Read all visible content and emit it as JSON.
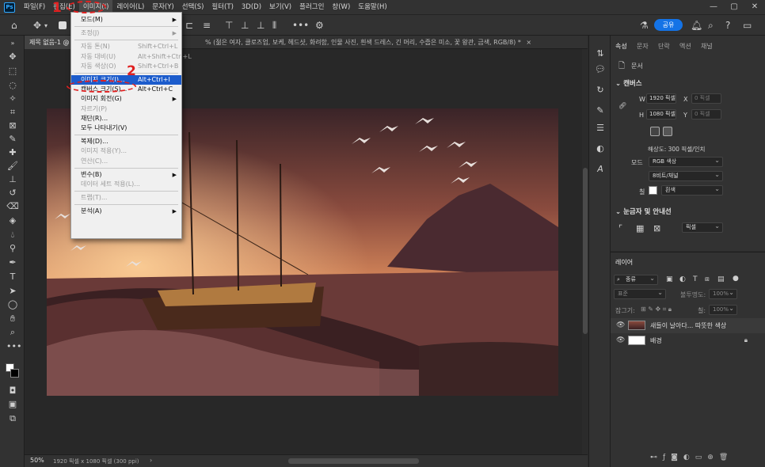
{
  "app": {
    "logo": "Ps"
  },
  "menubar": {
    "items": [
      "파일(F)",
      "편집(E)",
      "이미지(I)",
      "레이어(L)",
      "문자(Y)",
      "선택(S)",
      "필터(T)",
      "3D(D)",
      "보기(V)",
      "플러그인",
      "창(W)",
      "도움말(H)"
    ],
    "active_index": 2
  },
  "window": {
    "minimize": "—",
    "maximize": "▢",
    "close": "✕"
  },
  "options_bar": {
    "share_label": "공유"
  },
  "document": {
    "tab_title": "제목 없음-1 @",
    "tab_suffix": "% (젊은 여자, 클로즈업, 보케, 헤드샷, 화려함, 인물 사진, 흰색 드레스, 긴 머리, 수줍은 미소, 꽃 왕관, 금색, RGB/8) *",
    "tab_close": "×"
  },
  "status": {
    "zoom": "50%",
    "info": "1920 픽셀 x 1080 픽셀 (300 ppi)",
    "arrow": "›"
  },
  "image_menu": {
    "items": [
      {
        "label": "모드(M)",
        "shortcut": "",
        "submenu": true,
        "enabled": true
      },
      {
        "sep": true
      },
      {
        "label": "조정(J)",
        "shortcut": "",
        "submenu": true,
        "enabled": false
      },
      {
        "sep": true
      },
      {
        "label": "자동 톤(N)",
        "shortcut": "Shift+Ctrl+L",
        "submenu": false,
        "enabled": false
      },
      {
        "label": "자동 대비(U)",
        "shortcut": "Alt+Shift+Ctrl+L",
        "submenu": false,
        "enabled": false
      },
      {
        "label": "자동 색상(O)",
        "shortcut": "Shift+Ctrl+B",
        "submenu": false,
        "enabled": false
      },
      {
        "sep": true
      },
      {
        "label": "이미지 크기(I)...",
        "shortcut": "Alt+Ctrl+I",
        "submenu": false,
        "enabled": true,
        "highlighted": true
      },
      {
        "label": "캔버스 크기(S)...",
        "shortcut": "Alt+Ctrl+C",
        "submenu": false,
        "enabled": true
      },
      {
        "label": "이미지 회전(G)",
        "shortcut": "",
        "submenu": true,
        "enabled": true
      },
      {
        "label": "자르기(P)",
        "shortcut": "",
        "submenu": false,
        "enabled": false
      },
      {
        "label": "재단(R)...",
        "shortcut": "",
        "submenu": false,
        "enabled": true
      },
      {
        "label": "모두 나타내기(V)",
        "shortcut": "",
        "submenu": false,
        "enabled": true
      },
      {
        "sep": true
      },
      {
        "label": "복제(D)...",
        "shortcut": "",
        "submenu": false,
        "enabled": true
      },
      {
        "label": "이미지 적용(Y)...",
        "shortcut": "",
        "submenu": false,
        "enabled": false
      },
      {
        "label": "연산(C)...",
        "shortcut": "",
        "submenu": false,
        "enabled": false
      },
      {
        "sep": true
      },
      {
        "label": "변수(B)",
        "shortcut": "",
        "submenu": true,
        "enabled": true
      },
      {
        "label": "데이터 세트 적용(L)...",
        "shortcut": "",
        "submenu": false,
        "enabled": false
      },
      {
        "sep": true
      },
      {
        "label": "트랩(T)...",
        "shortcut": "",
        "submenu": false,
        "enabled": false
      },
      {
        "sep": true
      },
      {
        "label": "분석(A)",
        "shortcut": "",
        "submenu": true,
        "enabled": true
      }
    ]
  },
  "annotations": {
    "step1": "1",
    "step2": "2"
  },
  "properties": {
    "tabs": [
      "속성",
      "문자",
      "단락",
      "액션",
      "채널"
    ],
    "doc_label": "문서",
    "canvas_title": "캔버스",
    "w_label": "W",
    "w_value": "1920 픽셀",
    "h_label": "H",
    "h_value": "1080 픽셀",
    "x_label": "X",
    "x_value": "0 픽셀",
    "y_label": "Y",
    "y_value": "0 픽셀",
    "resolution": "해상도: 300 픽셀/인치",
    "mode_label": "모드",
    "mode_value": "RGB 색상",
    "depth_value": "8비트/채널",
    "fill_label": "칠",
    "fill_value": "흰색",
    "rulers_title": "눈금자 및 안내선",
    "units_value": "픽셀"
  },
  "layers": {
    "tab": "레이어",
    "filter_kind": "종류",
    "blend_mode": "표준",
    "opacity_label": "불투명도:",
    "opacity_value": "100%",
    "lock_label": "잠그기:",
    "fill_label": "칠:",
    "fill_value": "100%",
    "items": [
      {
        "name": "새들이 날아다... 따뜻한 색상",
        "visible": true,
        "locked": false
      },
      {
        "name": "배경",
        "visible": true,
        "locked": true
      }
    ]
  },
  "colors": {
    "accent": "#1473e6",
    "highlight": "#1c5ccc",
    "callout": "#e02020"
  }
}
